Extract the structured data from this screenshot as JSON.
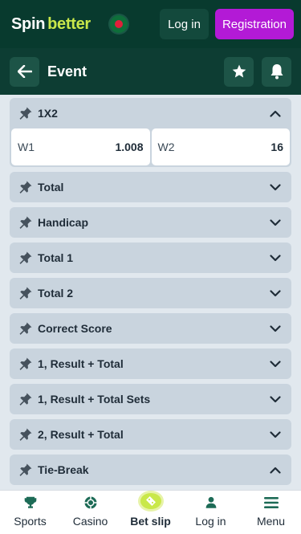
{
  "header": {
    "logo_spin": "Spin",
    "logo_better": "better",
    "login": "Log in",
    "registration": "Registration"
  },
  "subheader": {
    "title": "Event"
  },
  "markets": [
    {
      "label": "1X2",
      "expanded": true,
      "odds": [
        {
          "label": "W1",
          "value": "1.008"
        },
        {
          "label": "W2",
          "value": "16"
        }
      ]
    },
    {
      "label": "Total",
      "expanded": false
    },
    {
      "label": "Handicap",
      "expanded": false
    },
    {
      "label": "Total 1",
      "expanded": false
    },
    {
      "label": "Total 2",
      "expanded": false
    },
    {
      "label": "Correct Score",
      "expanded": false
    },
    {
      "label": "1, Result + Total",
      "expanded": false
    },
    {
      "label": "1, Result + Total Sets",
      "expanded": false
    },
    {
      "label": "2, Result + Total",
      "expanded": false
    },
    {
      "label": "Tie-Break",
      "expanded": true
    }
  ],
  "bottom_nav": [
    {
      "label": "Sports",
      "icon": "trophy-icon"
    },
    {
      "label": "Casino",
      "icon": "chip-icon"
    },
    {
      "label": "Bet slip",
      "icon": "ticket-icon"
    },
    {
      "label": "Log in",
      "icon": "user-icon"
    },
    {
      "label": "Menu",
      "icon": "menu-icon"
    }
  ],
  "colors": {
    "header_bg": "#083a2e",
    "accent_lime": "#c9e84a",
    "registration": "#b31ad6"
  }
}
